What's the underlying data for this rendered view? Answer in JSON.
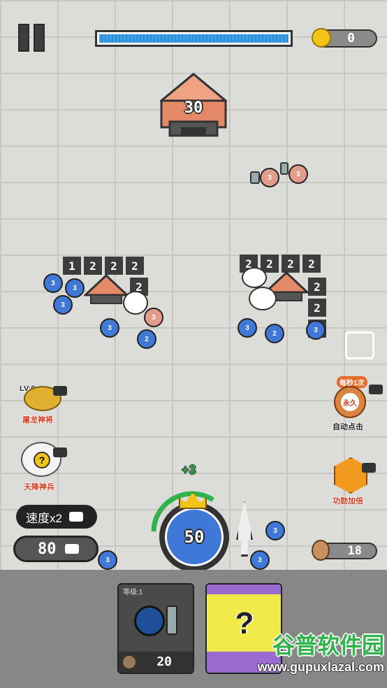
{
  "hud": {
    "coins": "0",
    "boss_hp_fraction": 1.0,
    "enemy_tower_count": "30"
  },
  "enemy_groups": {
    "left_tiles": [
      "1",
      "2",
      "2",
      "2"
    ],
    "left_tile_extra": "2",
    "right_tiles_row": [
      "2",
      "2",
      "2",
      "2"
    ],
    "right_tiles_col": [
      "2",
      "2",
      "2"
    ]
  },
  "units": {
    "blue": [
      "3",
      "3",
      "3",
      "3",
      "2",
      "3",
      "2",
      "3",
      "3"
    ],
    "red": [
      "3",
      "3",
      "3"
    ]
  },
  "left_panel": {
    "lv_label": "LV:0",
    "dragon_label": "屠龙神将",
    "soldier_label": "天降神兵",
    "speed_label": "速度x2",
    "cost_value": "80"
  },
  "right_panel": {
    "per_second_label": "每秒1次",
    "permanent_badge": "永久",
    "auto_click_label": "自动点击",
    "merit_label": "功勋加倍",
    "medal_value": "18"
  },
  "player": {
    "base_value": "50",
    "bonus_text": "+3"
  },
  "cards": {
    "card1_level": "等级:1",
    "card1_cost": "20",
    "card2_symbol": "?"
  },
  "watermark": {
    "main": "谷普软件园",
    "url": "www.gupuxlazal.com"
  },
  "colors": {
    "unit_blue": "#3f78d6",
    "unit_red": "#e39b8c",
    "hp_fill": "#3ea0e8",
    "coin": "#f2c41a",
    "tower_roof": "#e48a68"
  }
}
